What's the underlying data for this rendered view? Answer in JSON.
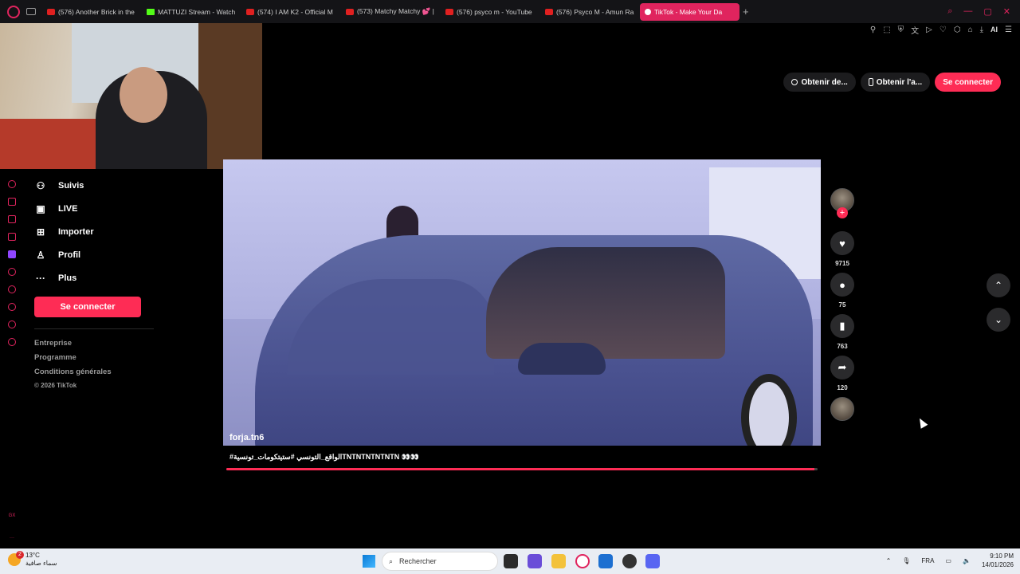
{
  "browser": {
    "tabs": [
      {
        "label": "(576) Another Brick in the",
        "type": "youtube"
      },
      {
        "label": "MATTUZI Stream - Watch",
        "type": "kick"
      },
      {
        "label": "(574) I AM K2 - Official M",
        "type": "youtube"
      },
      {
        "label": "(573) Matchy Matchy 💕 |",
        "type": "youtube"
      },
      {
        "label": "(576) psyco m - YouTube",
        "type": "youtube"
      },
      {
        "label": "(576) Psyco M - Amun Ra",
        "type": "youtube"
      },
      {
        "label": "TikTok - Make Your Da",
        "type": "tiktok",
        "active": true
      }
    ],
    "new_tab": "+",
    "ai_label": "AI",
    "accent": "#e0245e"
  },
  "tiktok": {
    "header": {
      "get_coins": "Obtenir de...",
      "get_app": "Obtenir l'a...",
      "login": "Se connecter"
    },
    "nav": [
      {
        "label": "Suivis",
        "icon": "following-icon"
      },
      {
        "label": "LIVE",
        "icon": "live-icon"
      },
      {
        "label": "Importer",
        "icon": "upload-icon"
      },
      {
        "label": "Profil",
        "icon": "profile-icon"
      },
      {
        "label": "Plus",
        "icon": "more-icon"
      }
    ],
    "login_button": "Se connecter",
    "footer": {
      "company": "Entreprise",
      "program": "Programme",
      "terms": "Conditions générales",
      "copyright": "© 2026 TikTok"
    },
    "video": {
      "username": "forja.tn6",
      "caption": "#الواقع_التونسي #ستيتكومات_تونسيةTNTNTNTNTNTN 👀👀",
      "progress": 0.995
    },
    "actions": {
      "likes": "9715",
      "comments": "75",
      "saves": "763",
      "shares": "120"
    },
    "brand_color": "#fe2c55"
  },
  "taskbar": {
    "weather_temp": "13°C",
    "weather_desc": "سماء صافية",
    "notification_count": "2",
    "search_placeholder": "Rechercher",
    "lang": "FRA",
    "time": "9:10 PM",
    "date": "14/01/2026"
  }
}
